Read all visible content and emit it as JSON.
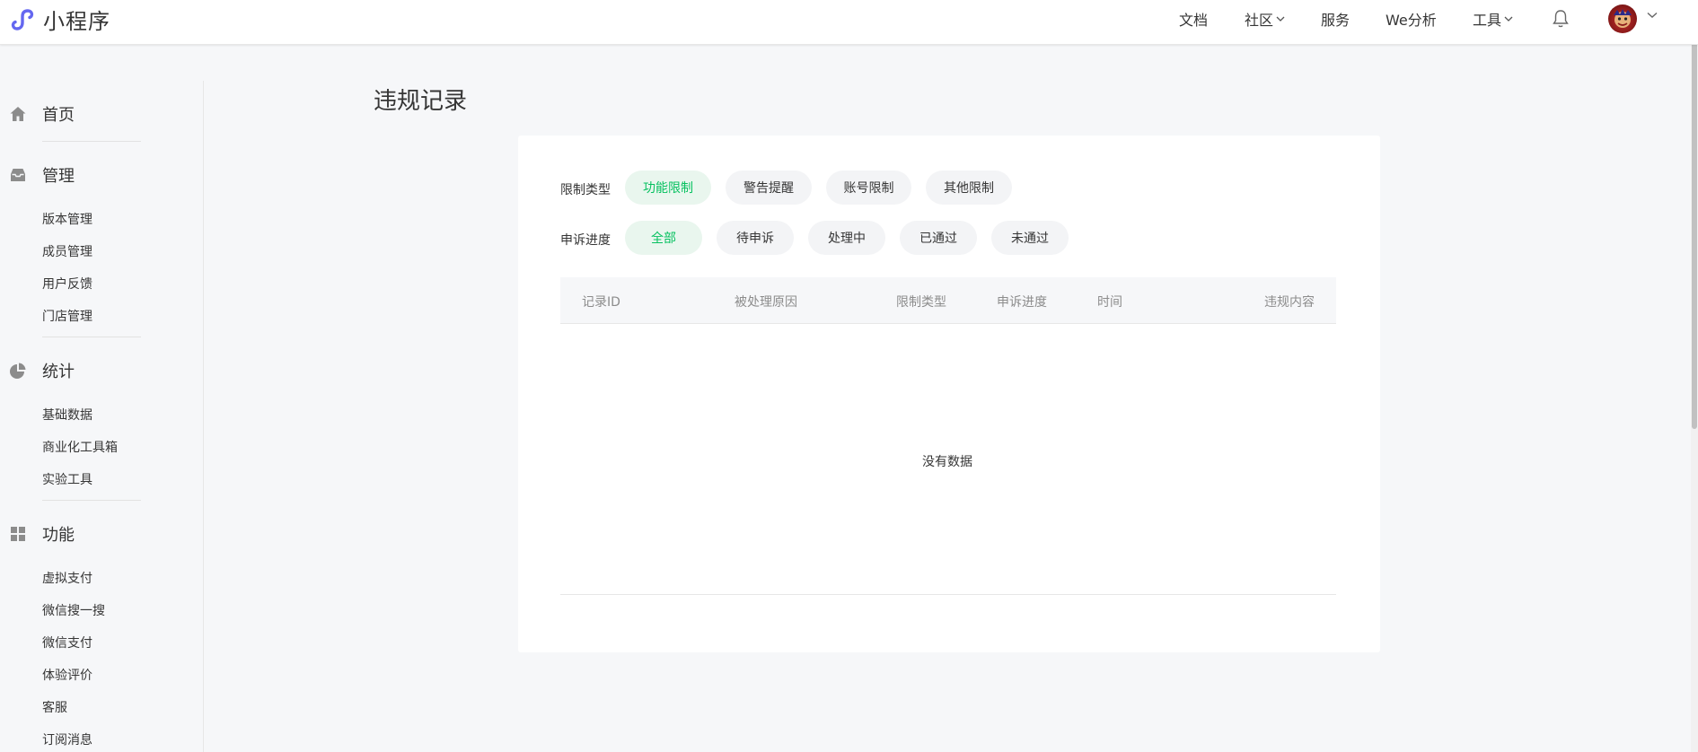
{
  "header": {
    "logo_text": "小程序",
    "nav": {
      "docs": "文档",
      "community": "社区",
      "services": "服务",
      "we_analysis": "We分析",
      "tools": "工具"
    },
    "bell_icon": "bell-icon",
    "avatar_icon": "avatar"
  },
  "sidebar": {
    "home": {
      "label": "首页",
      "icon": "home-icon"
    },
    "manage": {
      "label": "管理",
      "icon": "inbox-icon",
      "items": [
        "版本管理",
        "成员管理",
        "用户反馈",
        "门店管理"
      ]
    },
    "stats": {
      "label": "统计",
      "icon": "pie-chart-icon",
      "items": [
        "基础数据",
        "商业化工具箱",
        "实验工具"
      ]
    },
    "features": {
      "label": "功能",
      "icon": "grid-icon",
      "items": [
        "虚拟支付",
        "微信搜一搜",
        "微信支付",
        "体验评价",
        "客服",
        "订阅消息"
      ]
    }
  },
  "main": {
    "title": "违规记录",
    "restriction": {
      "label": "限制类型",
      "options": [
        "功能限制",
        "警告提醒",
        "账号限制",
        "其他限制"
      ],
      "selected": "功能限制"
    },
    "appeal": {
      "label": "申诉进度",
      "options": [
        "全部",
        "待申诉",
        "处理中",
        "已通过",
        "未通过"
      ],
      "selected": "全部"
    },
    "table": {
      "columns": [
        "记录ID",
        "被处理原因",
        "限制类型",
        "申诉进度",
        "时间",
        "违规内容"
      ],
      "rows": [],
      "empty_text": "没有数据"
    }
  },
  "colors": {
    "accent": "#07c160",
    "accent_bg": "#e9f6ee",
    "logo": "#6467f0",
    "background": "#f6f7f9"
  }
}
